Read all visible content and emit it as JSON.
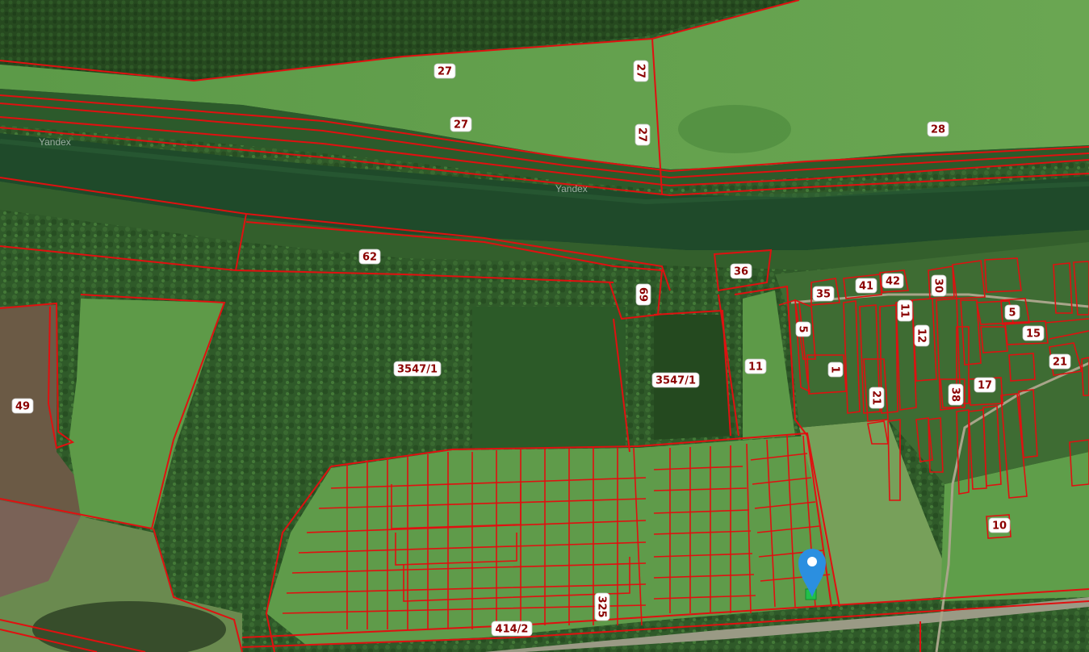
{
  "map": {
    "watermark": "Yandex",
    "labels": [
      "27",
      "27",
      "27",
      "27",
      "28",
      "62",
      "69",
      "36",
      "35",
      "41",
      "42",
      "30",
      "11",
      "5",
      "15",
      "21",
      "12",
      "5",
      "1",
      "21",
      "38",
      "17",
      "11",
      "3547/1",
      "3547/1",
      "49",
      "10",
      "325",
      "414/2"
    ],
    "marker": {
      "color": "#2b8fe0",
      "selected_parcel_color": "#22c04a"
    },
    "colors": {
      "boundary": "#e01010",
      "label_text": "#8b0000",
      "river": "#1f4a2a",
      "field": "#5ea14a",
      "forest": "#2f5e2a"
    }
  }
}
